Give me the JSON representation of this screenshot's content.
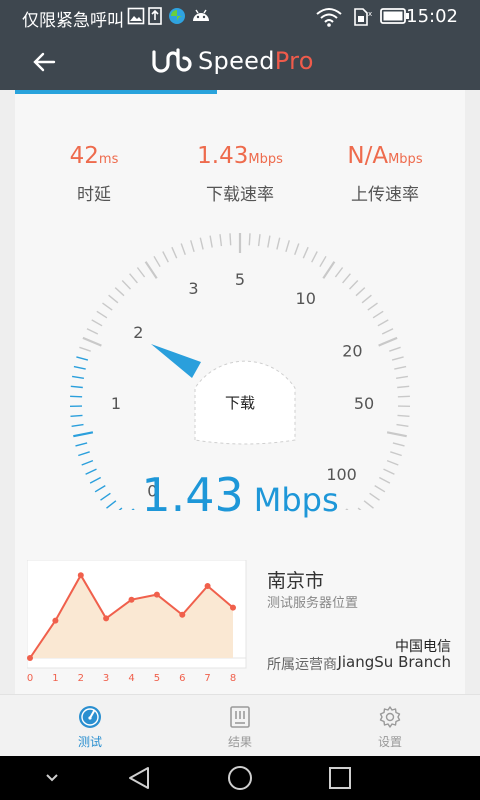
{
  "status_bar": {
    "notification_text": "仅限紧急呼叫",
    "time": "15:02",
    "icons": [
      "image-icon",
      "sim-icon",
      "vpn-icon",
      "android-icon",
      "wifi-icon",
      "sim-signal-icon",
      "battery-icon"
    ]
  },
  "app_bar": {
    "logo_text_a": "Speed",
    "logo_text_b": "Pro"
  },
  "stats": {
    "latency_value": "42",
    "latency_unit": "ms",
    "latency_label": "时延",
    "download_value": "1.43",
    "download_unit": "Mbps",
    "download_label": "下载速率",
    "upload_value": "N/A",
    "upload_unit": "Mbps",
    "upload_label": "上传速率"
  },
  "gauge": {
    "labels": [
      "0",
      "1",
      "2",
      "3",
      "5",
      "10",
      "20",
      "50",
      "100"
    ],
    "center_label": "下载",
    "current_mbps": 1.43
  },
  "result": {
    "speed_value": "1.43",
    "speed_unit": "Mbps"
  },
  "chart_data": {
    "type": "area",
    "x": [
      0,
      1,
      2,
      3,
      4,
      5,
      6,
      7,
      8
    ],
    "values": [
      0.0,
      0.52,
      1.15,
      0.55,
      0.81,
      0.88,
      0.6,
      1.0,
      0.7
    ],
    "tick_labels": [
      "0",
      "1",
      "2",
      "3",
      "4",
      "5",
      "6",
      "7",
      "8"
    ],
    "ylim": [
      0,
      1.25
    ],
    "line_color": "#f0604c",
    "fill_color": "#fae8d3"
  },
  "server": {
    "city": "南京市",
    "subtitle": "测试服务器位置",
    "isp": "中国电信",
    "isp_label": "所属运营商",
    "branch": "JiangSu Branch"
  },
  "tabs": [
    {
      "label": "测试",
      "icon": "speedometer-icon",
      "active": true
    },
    {
      "label": "结果",
      "icon": "results-list-icon",
      "active": false
    },
    {
      "label": "设置",
      "icon": "gear-icon",
      "active": false
    }
  ],
  "colors": {
    "header": "#3e474f",
    "accent": "#29a3dc",
    "stat": "#ee6b4d"
  }
}
